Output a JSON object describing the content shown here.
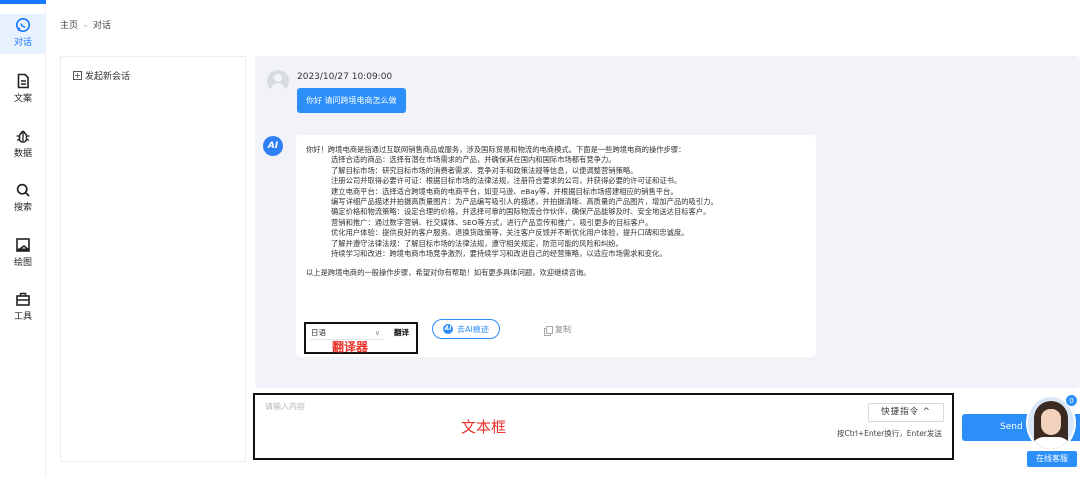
{
  "nav": {
    "active_color": "#1677ff",
    "items": [
      {
        "label": "对话",
        "icon": "chat-bubble-icon"
      },
      {
        "label": "文案",
        "icon": "document-icon"
      },
      {
        "label": "数据",
        "icon": "data-bug-icon"
      },
      {
        "label": "搜索",
        "icon": "search-icon"
      },
      {
        "label": "绘图",
        "icon": "image-icon"
      },
      {
        "label": "工具",
        "icon": "toolbox-icon"
      }
    ]
  },
  "breadcrumb": {
    "home": "主页",
    "separator": "-",
    "current": "对话"
  },
  "sidebar": {
    "new_conversation": "发起新会话"
  },
  "chat": {
    "user_message": {
      "time": "2023/10/27 10:09:00",
      "text": "你好 请问跨境电商怎么做"
    },
    "ai_message": {
      "intro": "你好！跨境电商是指通过互联网销售商品或服务，涉及国际贸易和物流的电商模式。下面是一些跨境电商的操作步骤：",
      "steps": [
        "选择合适的商品：选择有潜在市场需求的产品，并确保其在国内和国际市场都有竞争力。",
        "了解目标市场：研究目标市场的消费者需求、竞争对手和政策法规等信息，以便调整营销策略。",
        "注册公司并取得必要许可证：根据目标市场的法律法规，注册符合要求的公司，并获得必要的许可证和证书。",
        "建立电商平台：选择适合跨境电商的电商平台，如亚马逊、eBay等，并根据目标市场搭建相应的销售平台。",
        "编写详细产品描述并拍摄高质量图片：为产品编写吸引人的描述，并拍摄清晰、高质量的产品图片，增加产品的吸引力。",
        "确定价格和物流策略：设定合理的价格，并选择可靠的国际物流合作伙伴，确保产品能够及时、安全地送达目标客户。",
        "营销和推广：通过数字营销、社交媒体、SEO等方式，进行产品宣传和推广，吸引更多的目标客户。",
        "优化用户体验：提供良好的客户服务、退换货政策等，关注客户反馈并不断优化用户体验，提升口碑和忠诚度。",
        "了解并遵守法律法规：了解目标市场的法律法规，遵守相关规定，防范可能的风险和纠纷。",
        "持续学习和改进：跨境电商市场竞争激烈，要持续学习和改进自己的经营策略，以适应市场需求和变化。"
      ],
      "outro": "以上是跨境电商的一般操作步骤，希望对你有帮助！如有更多具体问题，欢迎继续咨询。",
      "language": "日语",
      "translate_label": "翻译",
      "translator_annotation": "翻译器",
      "polish_label": "去AI痕迹",
      "copy_label": "复制"
    }
  },
  "input": {
    "placeholder": "请输入内容",
    "annotation": "文本框",
    "shortcut_label": "快捷指令 ^",
    "hint": "按Ctrl+Enter换行，Enter发送",
    "send_label": "Send"
  },
  "customer_service": {
    "label": "在线客服",
    "badge": "0"
  },
  "colors": {
    "primary": "#2b8ef9",
    "annotation_red": "#e8332b",
    "chat_bg": "#f1f3f8"
  }
}
